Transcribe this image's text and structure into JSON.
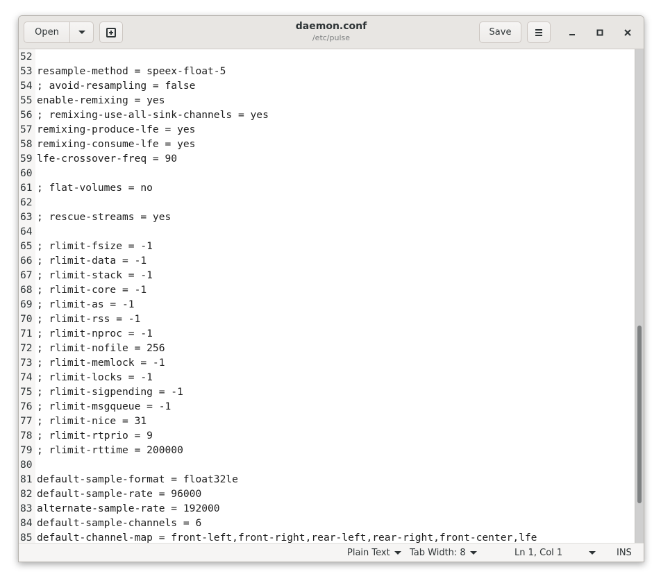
{
  "header": {
    "open_label": "Open",
    "title": "daemon.conf",
    "subtitle": "/etc/pulse",
    "save_label": "Save"
  },
  "editor": {
    "lines": [
      {
        "n": "52",
        "text": ""
      },
      {
        "n": "53",
        "text": "resample-method = speex-float-5"
      },
      {
        "n": "54",
        "text": "; avoid-resampling = false"
      },
      {
        "n": "55",
        "text": "enable-remixing = yes"
      },
      {
        "n": "56",
        "text": "; remixing-use-all-sink-channels = yes"
      },
      {
        "n": "57",
        "text": "remixing-produce-lfe = yes"
      },
      {
        "n": "58",
        "text": "remixing-consume-lfe = yes"
      },
      {
        "n": "59",
        "text": "lfe-crossover-freq = 90"
      },
      {
        "n": "60",
        "text": ""
      },
      {
        "n": "61",
        "text": "; flat-volumes = no"
      },
      {
        "n": "62",
        "text": ""
      },
      {
        "n": "63",
        "text": "; rescue-streams = yes"
      },
      {
        "n": "64",
        "text": ""
      },
      {
        "n": "65",
        "text": "; rlimit-fsize = -1"
      },
      {
        "n": "66",
        "text": "; rlimit-data = -1"
      },
      {
        "n": "67",
        "text": "; rlimit-stack = -1"
      },
      {
        "n": "68",
        "text": "; rlimit-core = -1"
      },
      {
        "n": "69",
        "text": "; rlimit-as = -1"
      },
      {
        "n": "70",
        "text": "; rlimit-rss = -1"
      },
      {
        "n": "71",
        "text": "; rlimit-nproc = -1"
      },
      {
        "n": "72",
        "text": "; rlimit-nofile = 256"
      },
      {
        "n": "73",
        "text": "; rlimit-memlock = -1"
      },
      {
        "n": "74",
        "text": "; rlimit-locks = -1"
      },
      {
        "n": "75",
        "text": "; rlimit-sigpending = -1"
      },
      {
        "n": "76",
        "text": "; rlimit-msgqueue = -1"
      },
      {
        "n": "77",
        "text": "; rlimit-nice = 31"
      },
      {
        "n": "78",
        "text": "; rlimit-rtprio = 9"
      },
      {
        "n": "79",
        "text": "; rlimit-rttime = 200000"
      },
      {
        "n": "80",
        "text": ""
      },
      {
        "n": "81",
        "text": "default-sample-format = float32le"
      },
      {
        "n": "82",
        "text": "default-sample-rate = 96000"
      },
      {
        "n": "83",
        "text": "alternate-sample-rate = 192000"
      },
      {
        "n": "84",
        "text": "default-sample-channels = 6"
      },
      {
        "n": "85",
        "text": "default-channel-map = front-left,front-right,rear-left,rear-right,front-center,lfe"
      }
    ]
  },
  "scrollbar": {
    "position_fraction": 0.56,
    "visible_fraction": 0.36
  },
  "statusbar": {
    "language": "Plain Text",
    "tab_width": "Tab Width: 8",
    "cursor_position": "Ln 1, Col 1",
    "insert_mode": "INS"
  }
}
